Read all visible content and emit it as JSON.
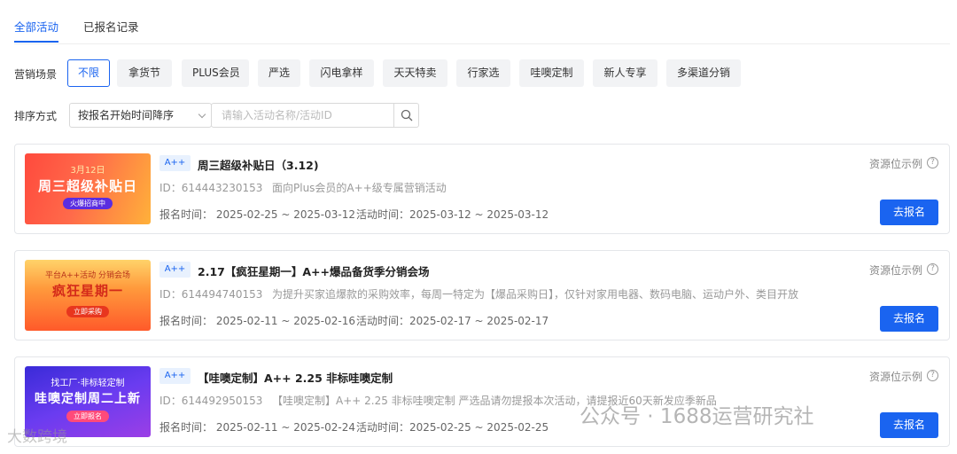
{
  "tabs": [
    {
      "label": "全部活动",
      "active": true
    },
    {
      "label": "已报名记录",
      "active": false
    }
  ],
  "filters": {
    "label": "营销场景",
    "chips": [
      "不限",
      "拿货节",
      "PLUS会员",
      "严选",
      "闪电拿样",
      "天天特卖",
      "行家选",
      "哇噢定制",
      "新人专享",
      "多渠道分销"
    ],
    "selected": "不限"
  },
  "sort": {
    "label": "排序方式",
    "selected": "按报名开始时间降序",
    "search_placeholder": "请输入活动名称/活动ID"
  },
  "activities": [
    {
      "banner": {
        "line1": "3月12日",
        "line2": "周三超级补贴日",
        "cta": "火爆招商中"
      },
      "grade": "A++",
      "title": "周三超级补贴日（3.12)",
      "id": "ID：614443230153",
      "desc": "面向Plus会员的A++级专属营销活动",
      "signup_time": "报名时间：  2025-02-25 ~ 2025-03-12",
      "activity_time": "活动时间：2025-03-12 ~ 2025-03-12",
      "resource_label": "资源位示例",
      "button": "去报名"
    },
    {
      "banner": {
        "line1": "平台A++活动 分销会场",
        "line2": "疯狂星期一",
        "cta": "立即采购"
      },
      "grade": "A++",
      "title": "2.17【疯狂星期一】A++爆品备货季分销会场",
      "id": "ID：614494740153",
      "desc": "为提升买家追爆款的采购效率，每周一特定为【爆品采购日】，仅针对家用电器、数码电脑、运动户外、类目开放",
      "signup_time": "报名时间：  2025-02-11 ~ 2025-02-16",
      "activity_time": "活动时间：2025-02-17 ~ 2025-02-17",
      "resource_label": "资源位示例",
      "button": "去报名"
    },
    {
      "banner": {
        "line1": "找工厂·非标轻定制",
        "line2": "哇噢定制周二上新",
        "cta": "立即报名"
      },
      "grade": "A++",
      "title": "【哇噢定制】A++ 2.25 非标哇噢定制",
      "id": "ID：614492950153",
      "desc": "【哇噢定制】A++ 2.25 非标哇噢定制 严选品请勿提报本次活动，请提报近60天新发应季新品",
      "signup_time": "报名时间：  2025-02-11 ~ 2025-02-24",
      "activity_time": "活动时间：2025-02-25 ~ 2025-02-25",
      "resource_label": "资源位示例",
      "button": "去报名"
    }
  ],
  "watermark": {
    "text": "公众号 · 1688运营研究社",
    "logo_text": "大数跨境"
  },
  "colors": {
    "primary": "#1a64f0",
    "chip_bg": "#f2f3f5",
    "tag_bg": "#e8f1fe"
  },
  "icons": {
    "search": "search-icon",
    "help": "question-circle-icon",
    "chevron": "chevron-down-icon"
  }
}
